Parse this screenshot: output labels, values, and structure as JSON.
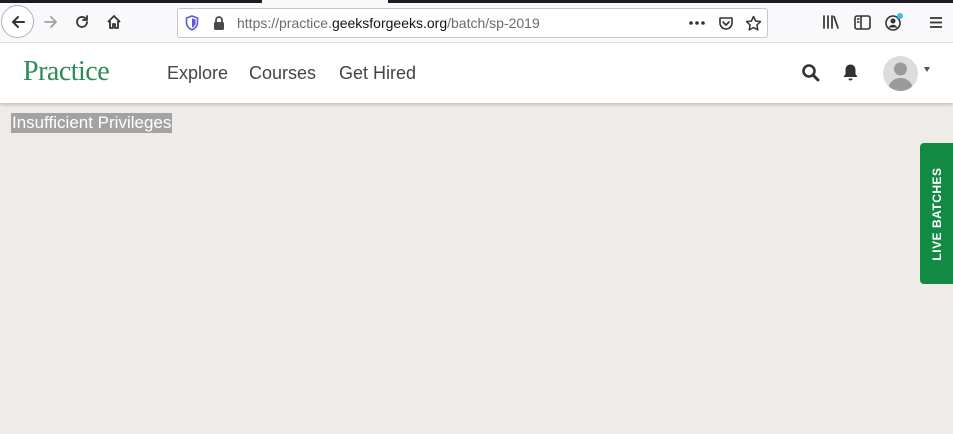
{
  "browser": {
    "url_prefix": "https://practice.",
    "url_host": "geeksforgeeks.org",
    "url_path": "/batch/sp-2019"
  },
  "header": {
    "logo": "Practice",
    "nav": [
      "Explore",
      "Courses",
      "Get Hired"
    ]
  },
  "main": {
    "message": "Insufficient Privileges"
  },
  "side_tab": {
    "label": "LIVE  BATCHES"
  },
  "colors": {
    "brand_green": "#2e8b57",
    "tab_green": "#138a43",
    "page_bg": "#efebe8"
  }
}
